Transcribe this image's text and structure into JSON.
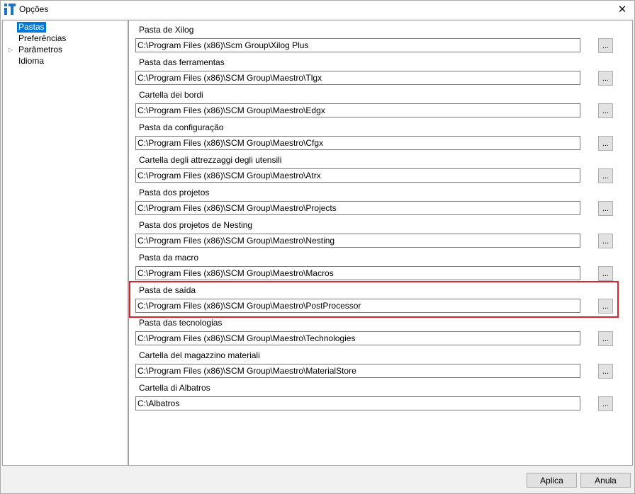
{
  "window": {
    "title": "Opções",
    "close_glyph": "✕"
  },
  "tree": {
    "items": [
      {
        "label": "Pastas",
        "selected": true,
        "expandable": false
      },
      {
        "label": "Preferências",
        "selected": false,
        "expandable": false
      },
      {
        "label": "Parâmetros",
        "selected": false,
        "expandable": true
      },
      {
        "label": "Idioma",
        "selected": false,
        "expandable": false
      }
    ],
    "expand_glyph": "▷"
  },
  "folders": [
    {
      "label": "Pasta de Xilog",
      "path": "C:\\Program Files (x86)\\Scm Group\\Xilog Plus"
    },
    {
      "label": "Pasta das ferramentas",
      "path": "C:\\Program Files (x86)\\SCM Group\\Maestro\\Tlgx"
    },
    {
      "label": "Cartella dei bordi",
      "path": "C:\\Program Files (x86)\\SCM Group\\Maestro\\Edgx"
    },
    {
      "label": "Pasta da configuração",
      "path": "C:\\Program Files (x86)\\SCM Group\\Maestro\\Cfgx"
    },
    {
      "label": "Cartella degli attrezzaggi degli utensili",
      "path": "C:\\Program Files (x86)\\SCM Group\\Maestro\\Atrx"
    },
    {
      "label": "Pasta dos projetos",
      "path": "C:\\Program Files (x86)\\SCM Group\\Maestro\\Projects"
    },
    {
      "label": "Pasta dos projetos de Nesting",
      "path": "C:\\Program Files (x86)\\SCM Group\\Maestro\\Nesting"
    },
    {
      "label": "Pasta da macro",
      "path": "C:\\Program Files (x86)\\SCM Group\\Maestro\\Macros"
    },
    {
      "label": "Pasta de saída",
      "path": "C:\\Program Files (x86)\\SCM Group\\Maestro\\PostProcessor"
    },
    {
      "label": "Pasta das tecnologias",
      "path": "C:\\Program Files (x86)\\SCM Group\\Maestro\\Technologies"
    },
    {
      "label": "Cartella del magazzino materiali",
      "path": "C:\\Program Files (x86)\\SCM Group\\Maestro\\MaterialStore"
    },
    {
      "label": "Cartella di Albatros",
      "path": "C:\\Albatros"
    }
  ],
  "browse_label": "...",
  "buttons": {
    "apply": "Aplica",
    "cancel": "Anula"
  },
  "colors": {
    "selection": "#0078d7",
    "highlight": "#e0202a",
    "logo": "#1e73c8"
  },
  "highlighted_folder": "Pasta de saída"
}
